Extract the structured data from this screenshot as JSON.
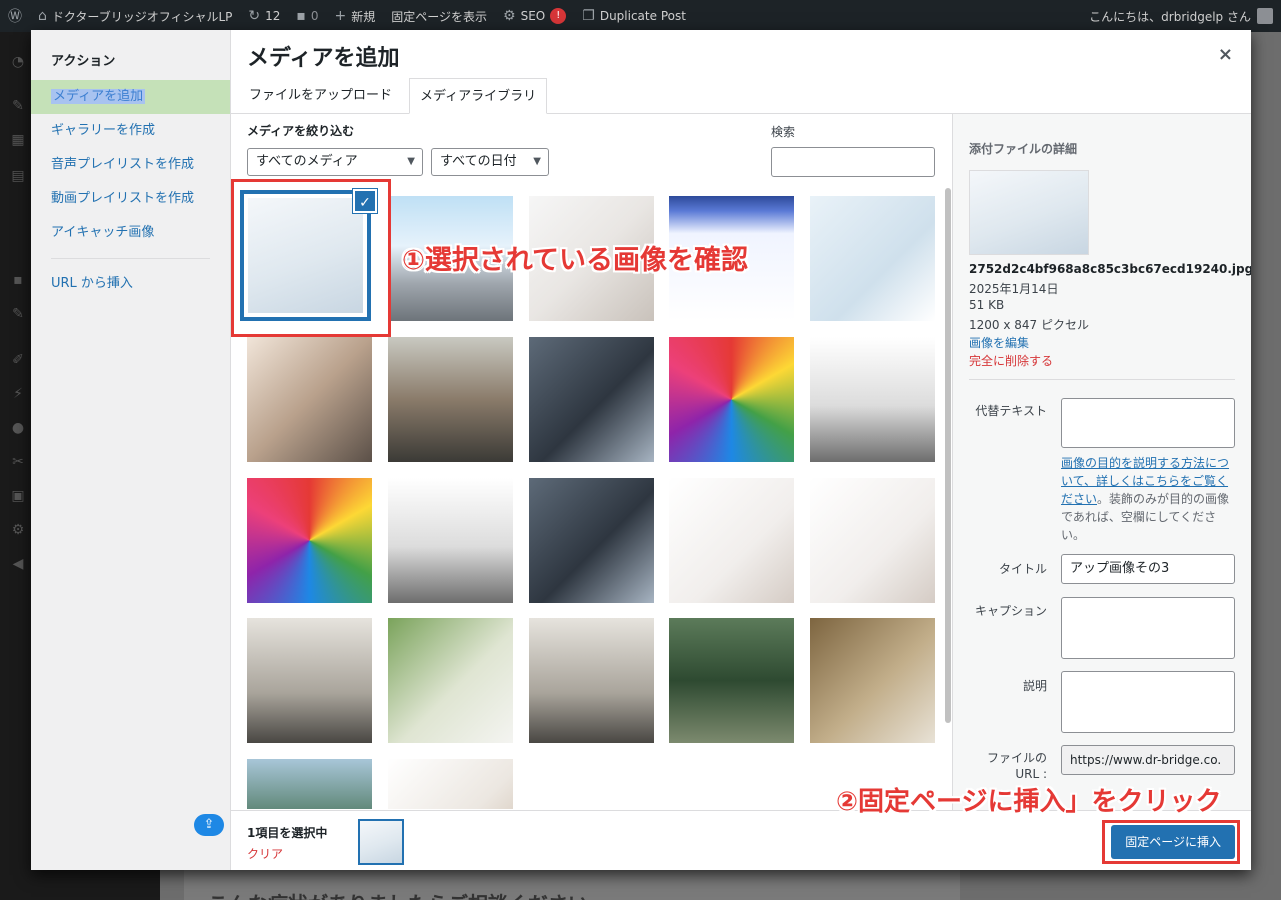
{
  "adminbar": {
    "site_name": "ドクターブリッジオフィシャルLP",
    "updates_count": "12",
    "comments_count": "0",
    "new_label": "新規",
    "view_page_label": "固定ページを表示",
    "seo_label": "SEO",
    "seo_badge": "!",
    "duplicate_label": "Duplicate Post",
    "greeting": "こんにちは、drbridgelp さん"
  },
  "modal": {
    "sidebar_title": "アクション",
    "sidebar_items": [
      "メディアを追加",
      "ギャラリーを作成",
      "音声プレイリストを作成",
      "動画プレイリストを作成",
      "アイキャッチ画像",
      "URL から挿入"
    ],
    "title": "メディアを追加",
    "close_glyph": "×",
    "tabs": [
      "ファイルをアップロード",
      "メディアライブラリ"
    ],
    "filter_label": "メディアを絞り込む",
    "filter_media": "すべてのメディア",
    "filter_date": "すべての日付",
    "search_label": "検索",
    "search_value": ""
  },
  "grid": {
    "items": [
      {
        "name": "keyboard-hand-photo",
        "selected": true
      },
      {
        "name": "building-exterior-photo"
      },
      {
        "name": "doctor-smiling-photo"
      },
      {
        "name": "recruitment-map-infographic"
      },
      {
        "name": "medical-staff-collage"
      },
      {
        "name": "office-women-tablet-photo"
      },
      {
        "name": "office-pingpong-photo"
      },
      {
        "name": "tablet-chart-photo"
      },
      {
        "name": "umbrellas-photo"
      },
      {
        "name": "woman-running-photo"
      },
      {
        "name": "umbrellas-photo-2"
      },
      {
        "name": "woman-running-photo-2"
      },
      {
        "name": "tablet-chart-photo-2"
      },
      {
        "name": "doctor-high-five-photo"
      },
      {
        "name": "doctor-high-five-photo-2"
      },
      {
        "name": "team-meeting-photo"
      },
      {
        "name": "elderly-woman-photo"
      },
      {
        "name": "team-meeting-photo-2"
      },
      {
        "name": "suspension-bridge-photo"
      },
      {
        "name": "elderly-woman-photo-2"
      },
      {
        "name": "lake-forest-photo"
      },
      {
        "name": "man-smiling-photo"
      }
    ],
    "checkmark": "✓"
  },
  "details": {
    "heading": "添付ファイルの詳細",
    "filename": "2752d2c4bf968a8c85c3bc67ecd19240.jpg",
    "date": "2025年1月14日",
    "size": "51 KB",
    "dimensions": "1200 x 847 ピクセル",
    "edit_link": "画像を編集",
    "delete_link": "完全に削除する",
    "alt_label": "代替テキスト",
    "alt_value": "",
    "alt_help_link": "画像の目的を説明する方法について、詳しくはこちらをご覧ください",
    "alt_help_text": "。装飾のみが目的の画像であれば、空欄にしてください。",
    "title_label": "タイトル",
    "title_value": "アップ画像その3",
    "caption_label": "キャプション",
    "caption_value": "",
    "description_label": "説明",
    "description_value": "",
    "url_label": "ファイルの URL :",
    "url_value": "https://www.dr-bridge.co."
  },
  "footer": {
    "selected_count": "1項目を選択中",
    "clear_label": "クリア",
    "insert_button": "固定ページに挿入"
  },
  "annotations": {
    "step1": "①選択されている画像を確認",
    "step2": "②固定ページに挿入」をクリック"
  },
  "upload_glyph": "⇪",
  "page_peek": "こんな症状がありましたらご相談ください"
}
